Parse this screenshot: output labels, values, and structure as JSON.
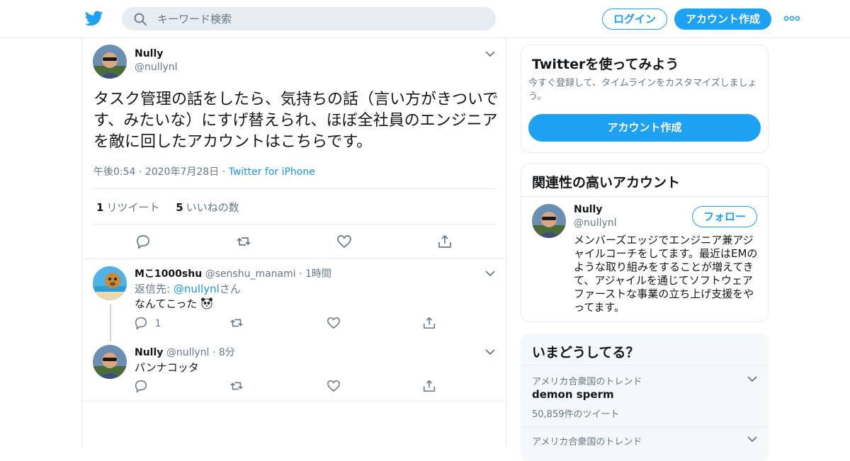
{
  "header": {
    "search_placeholder": "キーワード検索",
    "login_label": "ログイン",
    "signup_label": "アカウント作成",
    "brand_color": "#1da1f2",
    "icons": {
      "logo": "twitter-bird-icon",
      "search": "search-icon",
      "more": "more-dots-icon"
    }
  },
  "main_tweet": {
    "name": "Nully",
    "handle": "@nullynl",
    "text": "タスク管理の話をしたら、気持ちの話（言い方がきついです、みたいな）にすげ替えられ、ほぼ全社員のエンジニアを敵に回したアカウントはこちらです。",
    "time": "午後0:54",
    "date": "2020年7月28日",
    "source": "Twitter for iPhone",
    "sep": "·",
    "retweets_count": "1",
    "retweets_label": "リツイート",
    "likes_count": "5",
    "likes_label": "いいねの数"
  },
  "replies": [
    {
      "name": "Mこ1000shu",
      "handle": "@senshu_manami",
      "time": "1時間",
      "reply_to_label": "返信先:",
      "reply_to_handle": "@nullynl",
      "reply_to_suffix": "さん",
      "text": "なんてこった",
      "reply_count": "1"
    },
    {
      "name": "Nully",
      "handle": "@nullynl",
      "time": "8分",
      "text": "パンナコッタ"
    }
  ],
  "signup_card": {
    "title": "Twitterを使ってみよう",
    "subtitle": "今すぐ登録して、タイムラインをカスタマイズしましょう。",
    "button": "アカウント作成"
  },
  "related_card": {
    "title": "関連性の高いアカウント",
    "name": "Nully",
    "handle": "@nullynl",
    "follow_label": "フォロー",
    "bio": "メンバーズエッジでエンジニア兼アジャイルコーチをしてます。最近はEMのような取り組みをすることが増えてきて、アジャイルを通じてソフトウェアファーストな事業の立ち上げ支援をやってます。"
  },
  "trends": {
    "title": "いまどうしてる？",
    "items": [
      {
        "location": "アメリカ合衆国のトレンド",
        "name": "demon sperm",
        "count": "50,859件のツイート"
      },
      {
        "location": "アメリカ合衆国のトレンド",
        "name": "",
        "count": ""
      }
    ]
  }
}
